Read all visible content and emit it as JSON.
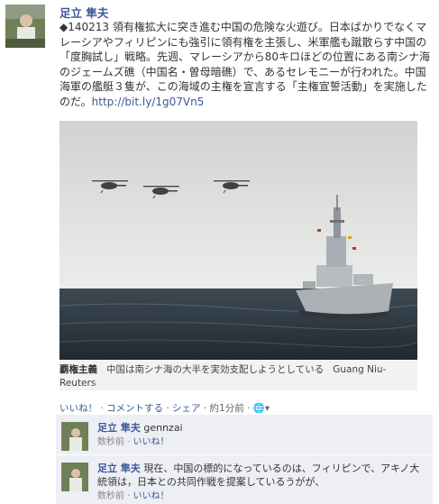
{
  "post": {
    "author": "足立 隼夫",
    "text": "◆140213 領有権拡大に突き進む中国の危険な火遊び。日本ばかりでなくマレーシアやフィリピンにも強引に領有権を主張し、米軍艦も蹴散らす中国の「度胸試し」戦略。先週、マレーシアから80キロほどの位置にある南シナ海のジェームズ礁（中国名・曽母暗礁）で、あるセレモニーが行われた。中国海軍の艦艇３隻が、この海域の主権を宣言する「主権宣誓活動」を実施したのだ。",
    "link": "http://bit.ly/1g07Vn5"
  },
  "photo_caption": {
    "title": "覇権主義",
    "text": "中国は南シナ海の大半を実効支配しようとしている",
    "credit": "Guang Niu-Reuters"
  },
  "actions": {
    "like": "いいね！",
    "comment": "コメントする",
    "share": "シェア",
    "time": "約1分前"
  },
  "comments": [
    {
      "author": "足立 隼夫",
      "text": "gennzai",
      "time": "数秒前",
      "like": "いいね！"
    },
    {
      "author": "足立 隼夫",
      "text": "現在、中国の標的になっているのは、フィリピンで、アキノ大統領は，日本との共同作戦を提案しているうがが、",
      "time": "数秒前",
      "like": "いいね！"
    }
  ]
}
